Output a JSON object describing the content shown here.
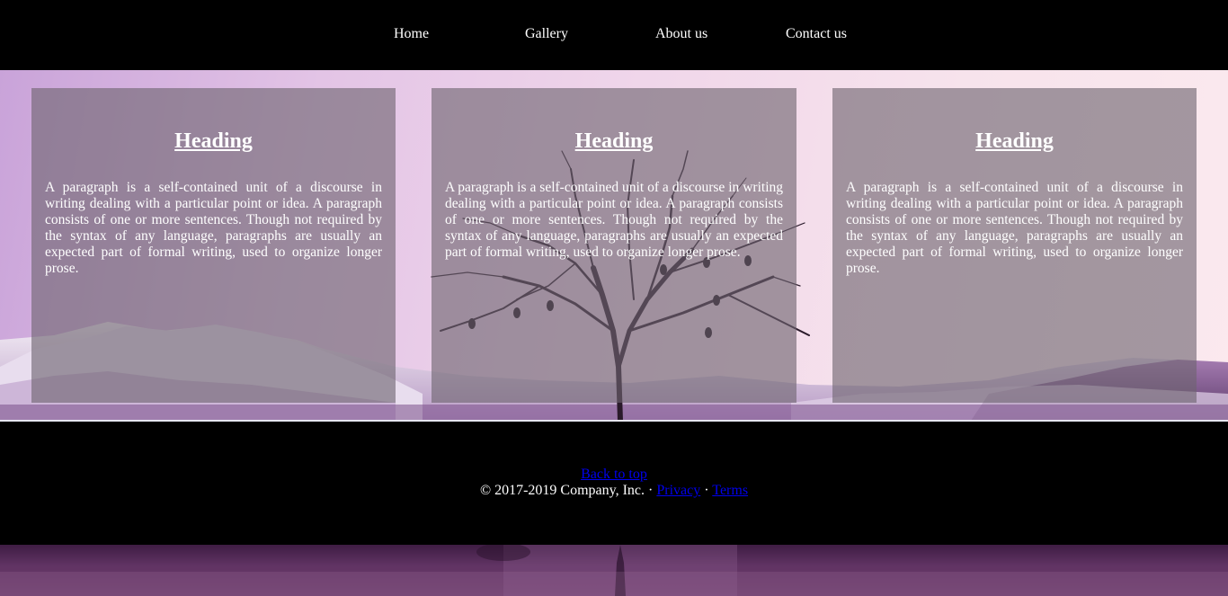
{
  "nav": {
    "items": [
      {
        "label": "Home"
      },
      {
        "label": "Gallery"
      },
      {
        "label": "About us"
      },
      {
        "label": "Contact us"
      }
    ]
  },
  "cards": [
    {
      "heading": "Heading",
      "text": "A paragraph is a self-contained unit of a discourse in writing dealing with a particular point or idea. A paragraph consists of one or more sentences. Though not required by the syntax of any language, paragraphs are usually an expected part of formal writing, used to organize longer prose."
    },
    {
      "heading": "Heading",
      "text": "A paragraph is a self-contained unit of a discourse in writing dealing with a particular point or idea. A paragraph consists of one or more sentences. Though not required by the syntax of any language, paragraphs are usually an expected part of formal writing, used to organize longer prose."
    },
    {
      "heading": "Heading",
      "text": "A paragraph is a self-contained unit of a discourse in writing dealing with a particular point or idea. A paragraph consists of one or more sentences. Though not required by the syntax of any language, paragraphs are usually an expected part of formal writing, used to organize longer prose."
    }
  ],
  "footer": {
    "back_to_top": "Back to top",
    "copyright": "© 2017-2019 Company, Inc. · ",
    "separator": " · ",
    "privacy": "Privacy",
    "terms": "Terms"
  },
  "colors": {
    "nav_background": "#000000",
    "card_overlay": "#6e6470",
    "link": "#0000ee",
    "text": "#ffffff"
  }
}
